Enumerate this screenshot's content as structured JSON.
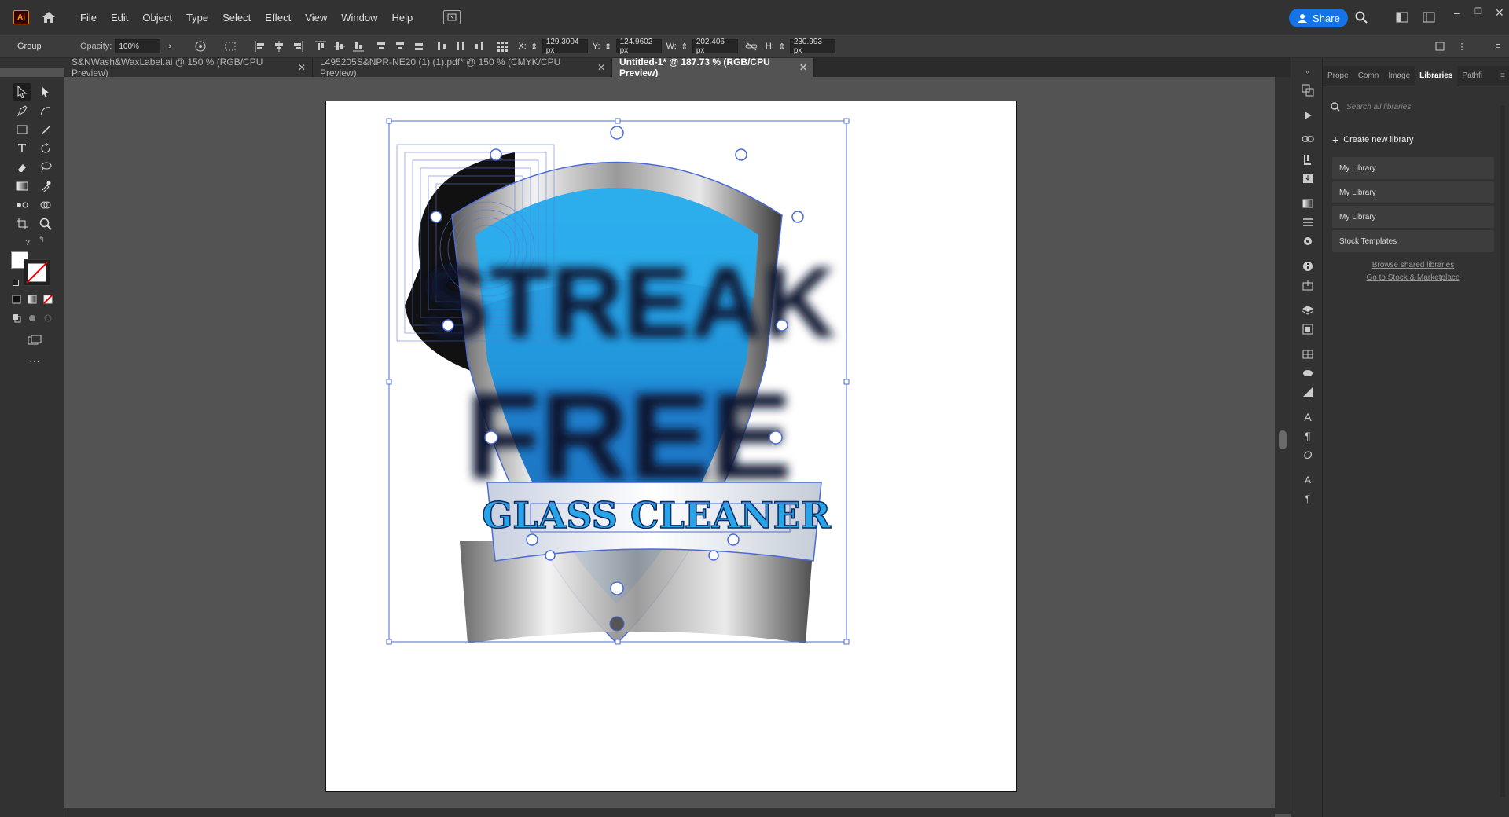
{
  "app": {
    "logo": "Ai"
  },
  "menu": [
    "File",
    "Edit",
    "Object",
    "Type",
    "Select",
    "Effect",
    "View",
    "Window",
    "Help"
  ],
  "share_label": "Share",
  "control_bar": {
    "selection": "Group",
    "opacity_label": "Opacity:",
    "opacity_value": "100%",
    "x_label": "X:",
    "x_value": "129.3004 px",
    "y_label": "Y:",
    "y_value": "124.9602 px",
    "w_label": "W:",
    "w_value": "202.406 px",
    "h_label": "H:",
    "h_value": "230.993 px"
  },
  "tabs": [
    {
      "label": "S&NWash&WaxLabel.ai @ 150 % (RGB/CPU Preview)",
      "active": false
    },
    {
      "label": "L495205S&NPR-NE20 (1) (1).pdf* @ 150 % (CMYK/CPU Preview)",
      "active": false
    },
    {
      "label": "Untitled-1* @ 187.73 % (RGB/CPU Preview)",
      "active": true
    }
  ],
  "artwork": {
    "headline_1": "STREAK",
    "headline_2": "FREE",
    "banner_text": "GLASS CLEANER",
    "shield_blue": "#1f93dc",
    "shield_blue_dark": "#1a6cbd",
    "selection_color": "#4b6bd6"
  },
  "panel": {
    "tabs": [
      "Prope",
      "Comn",
      "Image",
      "Libraries",
      "Pathfi"
    ],
    "active_tab": "Libraries",
    "search_placeholder": "Search all libraries",
    "create_label": "Create new library",
    "libraries": [
      "My Library",
      "My Library",
      "My Library",
      "Stock Templates"
    ],
    "browse_link": "Browse shared libraries",
    "stock_link": "Go to Stock & Marketplace"
  },
  "colors": {
    "ui_dark": "#323232",
    "ui_canvas": "#535353",
    "accent": "#1473e6"
  }
}
